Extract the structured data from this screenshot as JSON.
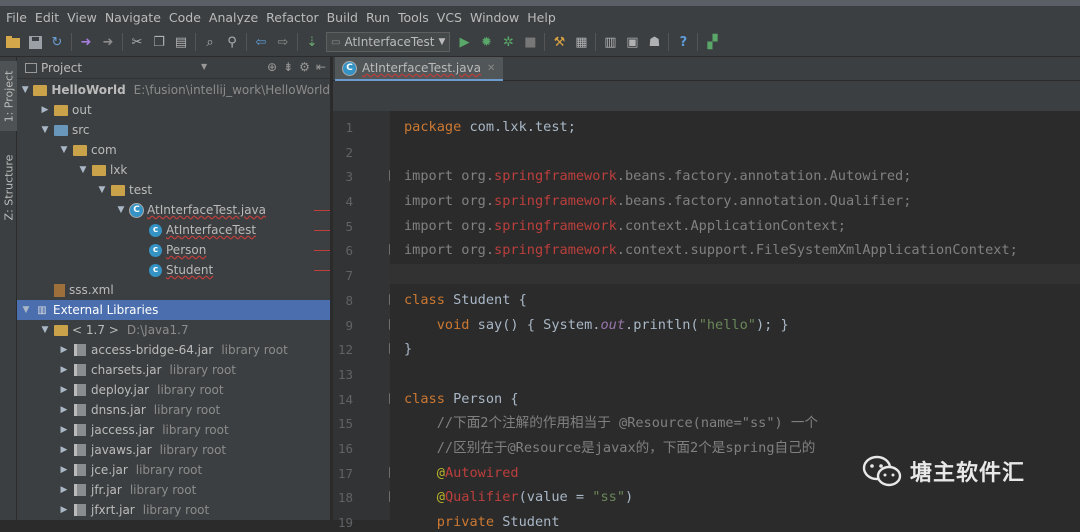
{
  "menu": [
    "File",
    "Edit",
    "View",
    "Navigate",
    "Code",
    "Analyze",
    "Refactor",
    "Build",
    "Run",
    "Tools",
    "VCS",
    "Window",
    "Help"
  ],
  "toolbar": {
    "run_config": "AtInterfaceTest",
    "icons": [
      "open-icon",
      "save-icon",
      "sync-icon",
      "undo-icon",
      "redo-icon",
      "cut-icon",
      "copy-icon",
      "paste-icon",
      "find-icon",
      "replace-icon",
      "back-icon",
      "forward-icon",
      "make-icon",
      "run-icon",
      "debug-icon",
      "coverage-icon",
      "stop-icon",
      "settings-icon",
      "project-structure-icon",
      "sdk-icon",
      "android-icon",
      "help-icon",
      "vcs-icon"
    ]
  },
  "side_tabs": {
    "project": "1: Project",
    "structure": "Z: Structure"
  },
  "project_panel": {
    "title": "Project",
    "tree": [
      {
        "label": "HelloWorld",
        "path": "E:\\fusion\\intellij_work\\HelloWorld",
        "level": 0,
        "icon": "module",
        "expanded": true
      },
      {
        "label": "out",
        "level": 1,
        "icon": "folder",
        "expanded": false
      },
      {
        "label": "src",
        "level": 1,
        "icon": "folder-blue",
        "expanded": true
      },
      {
        "label": "com",
        "level": 2,
        "icon": "package",
        "expanded": true
      },
      {
        "label": "lxk",
        "level": 3,
        "icon": "package",
        "expanded": true
      },
      {
        "label": "test",
        "level": 4,
        "icon": "package",
        "expanded": true
      },
      {
        "label": "AtInterfaceTest.java",
        "level": 5,
        "icon": "java-file",
        "expanded": true,
        "error": true
      },
      {
        "label": "AtInterfaceTest",
        "level": 6,
        "icon": "class",
        "error": true
      },
      {
        "label": "Person",
        "level": 6,
        "icon": "class",
        "error": true
      },
      {
        "label": "Student",
        "level": 6,
        "icon": "class",
        "error": true
      },
      {
        "label": "sss.xml",
        "level": 1,
        "icon": "xml"
      },
      {
        "label": "External Libraries",
        "level": 0,
        "icon": "libraries",
        "expanded": true,
        "selected": true
      },
      {
        "label": "< 1.7 >",
        "path": "D:\\Java1.7",
        "level": 1,
        "icon": "jdk",
        "expanded": true
      },
      {
        "label": "access-bridge-64.jar",
        "path": "library root",
        "level": 2,
        "icon": "jar"
      },
      {
        "label": "charsets.jar",
        "path": "library root",
        "level": 2,
        "icon": "jar"
      },
      {
        "label": "deploy.jar",
        "path": "library root",
        "level": 2,
        "icon": "jar"
      },
      {
        "label": "dnsns.jar",
        "path": "library root",
        "level": 2,
        "icon": "jar"
      },
      {
        "label": "jaccess.jar",
        "path": "library root",
        "level": 2,
        "icon": "jar"
      },
      {
        "label": "javaws.jar",
        "path": "library root",
        "level": 2,
        "icon": "jar"
      },
      {
        "label": "jce.jar",
        "path": "library root",
        "level": 2,
        "icon": "jar"
      },
      {
        "label": "jfr.jar",
        "path": "library root",
        "level": 2,
        "icon": "jar"
      },
      {
        "label": "jfxrt.jar",
        "path": "library root",
        "level": 2,
        "icon": "jar"
      }
    ]
  },
  "editor": {
    "tab": "AtInterfaceTest.java",
    "line_numbers": [
      "1",
      "2",
      "3",
      "4",
      "5",
      "6",
      "7",
      "8",
      "9",
      "12",
      "13",
      "14",
      "15",
      "16",
      "17",
      "18",
      "19"
    ]
  },
  "watermark": "塘主软件汇"
}
